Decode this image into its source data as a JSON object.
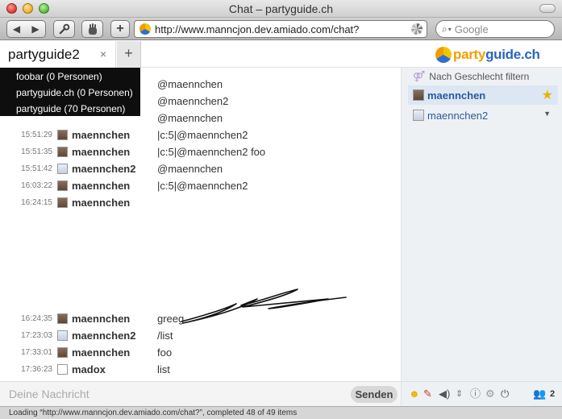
{
  "window": {
    "title": "Chat – partyguide.ch"
  },
  "toolbar": {
    "add_label": "+",
    "url": "http://www.manncjon.dev.amiado.com/chat?",
    "search_placeholder": "Google"
  },
  "tabs": {
    "active_label": "partyguide2",
    "close_glyph": "×",
    "add_glyph": "+"
  },
  "brand": {
    "part1": "party",
    "part2": "guide.ch"
  },
  "rooms": [
    "foobar (0 Personen)",
    "partyguide.ch (0 Personen)",
    "partyguide (70 Personen)"
  ],
  "messages": [
    {
      "time": "",
      "user": "",
      "avatar": "none",
      "text": "@maennchen"
    },
    {
      "time": "",
      "user": "",
      "avatar": "none",
      "text": "@maennchen2"
    },
    {
      "time": "",
      "user": "",
      "avatar": "none",
      "text": "@maennchen"
    },
    {
      "time": "15:51:29",
      "user": "maennchen",
      "avatar": "maennchen",
      "text": "|c:5|@maennchen2"
    },
    {
      "time": "15:51:35",
      "user": "maennchen",
      "avatar": "maennchen",
      "text": "|c:5|@maennchen2 foo"
    },
    {
      "time": "15:51:42",
      "user": "maennchen2",
      "avatar": "maennchen2",
      "text": "@maennchen"
    },
    {
      "time": "16:03:22",
      "user": "maennchen",
      "avatar": "maennchen",
      "text": "|c:5|@maennchen2"
    },
    {
      "time": "16:24:15",
      "user": "maennchen",
      "avatar": "maennchen",
      "text": ""
    },
    {
      "time": "16:24:35",
      "user": "maennchen",
      "avatar": "maennchen",
      "text": "greeg"
    },
    {
      "time": "17:23:03",
      "user": "maennchen2",
      "avatar": "maennchen2",
      "text": "/list"
    },
    {
      "time": "17:33:01",
      "user": "maennchen",
      "avatar": "maennchen",
      "text": "foo"
    },
    {
      "time": "17:36:23",
      "user": "madox",
      "avatar": "blank",
      "text": "list"
    }
  ],
  "sidebar": {
    "gender_filter": "Nach Geschlecht filtern",
    "users": [
      {
        "name": "maennchen",
        "self": true,
        "icon": "star-icon"
      },
      {
        "name": "maennchen2",
        "self": false,
        "icon": "chevron-down-icon"
      }
    ]
  },
  "composer": {
    "placeholder": "Deine Nachricht",
    "send_label": "Senden"
  },
  "tools": {
    "user_count": "2"
  },
  "status": {
    "text": "Loading “http://www.manncjon.dev.amiado.com/chat?”, completed 48 of 49 items"
  },
  "colors": {
    "brand_orange": "#f0a000",
    "brand_blue": "#2a64c0",
    "self_highlight": "#dde7f3"
  }
}
